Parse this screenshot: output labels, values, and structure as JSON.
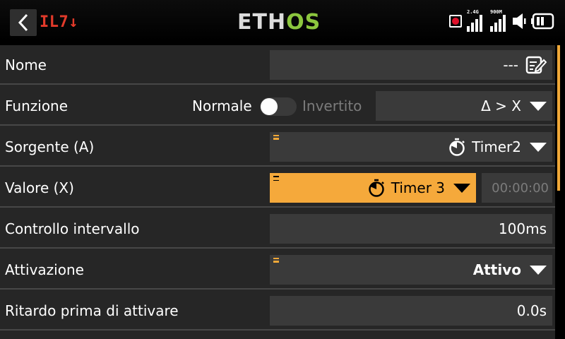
{
  "header": {
    "model_name": "IL7↓",
    "logo_left": "ETH",
    "logo_right": "OS",
    "signal1_label": "2.4G",
    "signal2_label": "900M"
  },
  "colors": {
    "accent": "#f0a838",
    "model_name": "#e23a2a",
    "logo_os": "#8cc63e",
    "record": "#e0112b"
  },
  "rows": {
    "nome": {
      "label": "Nome",
      "value": "---"
    },
    "funzione": {
      "label": "Funzione",
      "opt_normal": "Normale",
      "opt_inverted": "Invertito",
      "value": "Δ > X"
    },
    "sorgente": {
      "label": "Sorgente (A)",
      "value": "Timer2"
    },
    "valore": {
      "label": "Valore (X)",
      "value": "Timer 3",
      "time": "00:00:00"
    },
    "intervallo": {
      "label": "Controllo intervallo",
      "value": "100ms"
    },
    "attivazione": {
      "label": "Attivazione",
      "value": "Attivo"
    },
    "ritardo": {
      "label": "Ritardo prima di attivare",
      "value": "0.0s"
    }
  }
}
